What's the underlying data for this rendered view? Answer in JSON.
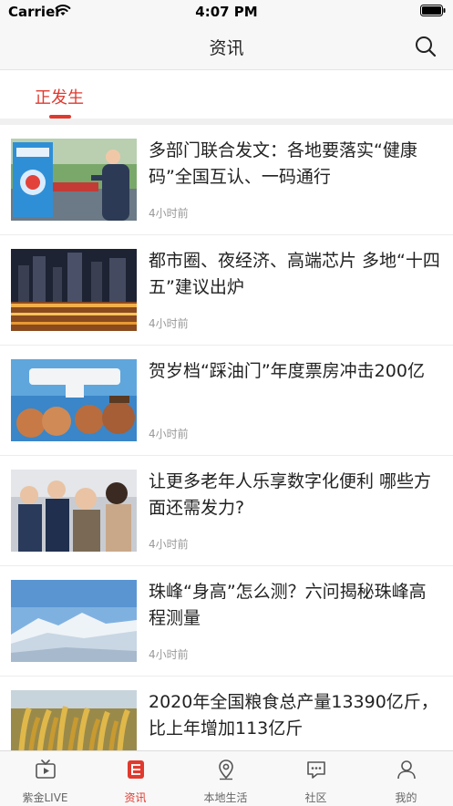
{
  "status_bar": {
    "carrier": "Carrier",
    "time": "4:07 PM"
  },
  "nav": {
    "title": "资讯",
    "search_icon": "search-icon"
  },
  "tabs": [
    {
      "label": "正发生",
      "active": true
    }
  ],
  "news": [
    {
      "title": "多部门联合发文：各地要落实“健康码”全国互认、一码通行",
      "time": "4小时前"
    },
    {
      "title": "都市圈、夜经济、高端芯片 多地“十四五”建议出炉",
      "time": "4小时前"
    },
    {
      "title": "贺岁档“踩油门”年度票房冲击200亿",
      "time": "4小时前"
    },
    {
      "title": "让更多老年人乐享数字化便利 哪些方面还需发力?",
      "time": "4小时前"
    },
    {
      "title": "珠峰“身高”怎么测？六问揭秘珠峰高程测量",
      "time": "4小时前"
    },
    {
      "title": "2020年全国粮食总产量13390亿斤，比上年增加113亿斤",
      "time": ""
    }
  ],
  "tab_bar": [
    {
      "label": "紫金LIVE",
      "icon": "tv-icon",
      "active": false
    },
    {
      "label": "资讯",
      "icon": "news-icon",
      "active": true
    },
    {
      "label": "本地生活",
      "icon": "location-pin-icon",
      "active": false
    },
    {
      "label": "社区",
      "icon": "chat-bubble-icon",
      "active": false
    },
    {
      "label": "我的",
      "icon": "person-icon",
      "active": false
    }
  ],
  "colors": {
    "accent": "#e03a2f",
    "meta_gray": "#999999",
    "tab_gray": "#666666"
  }
}
